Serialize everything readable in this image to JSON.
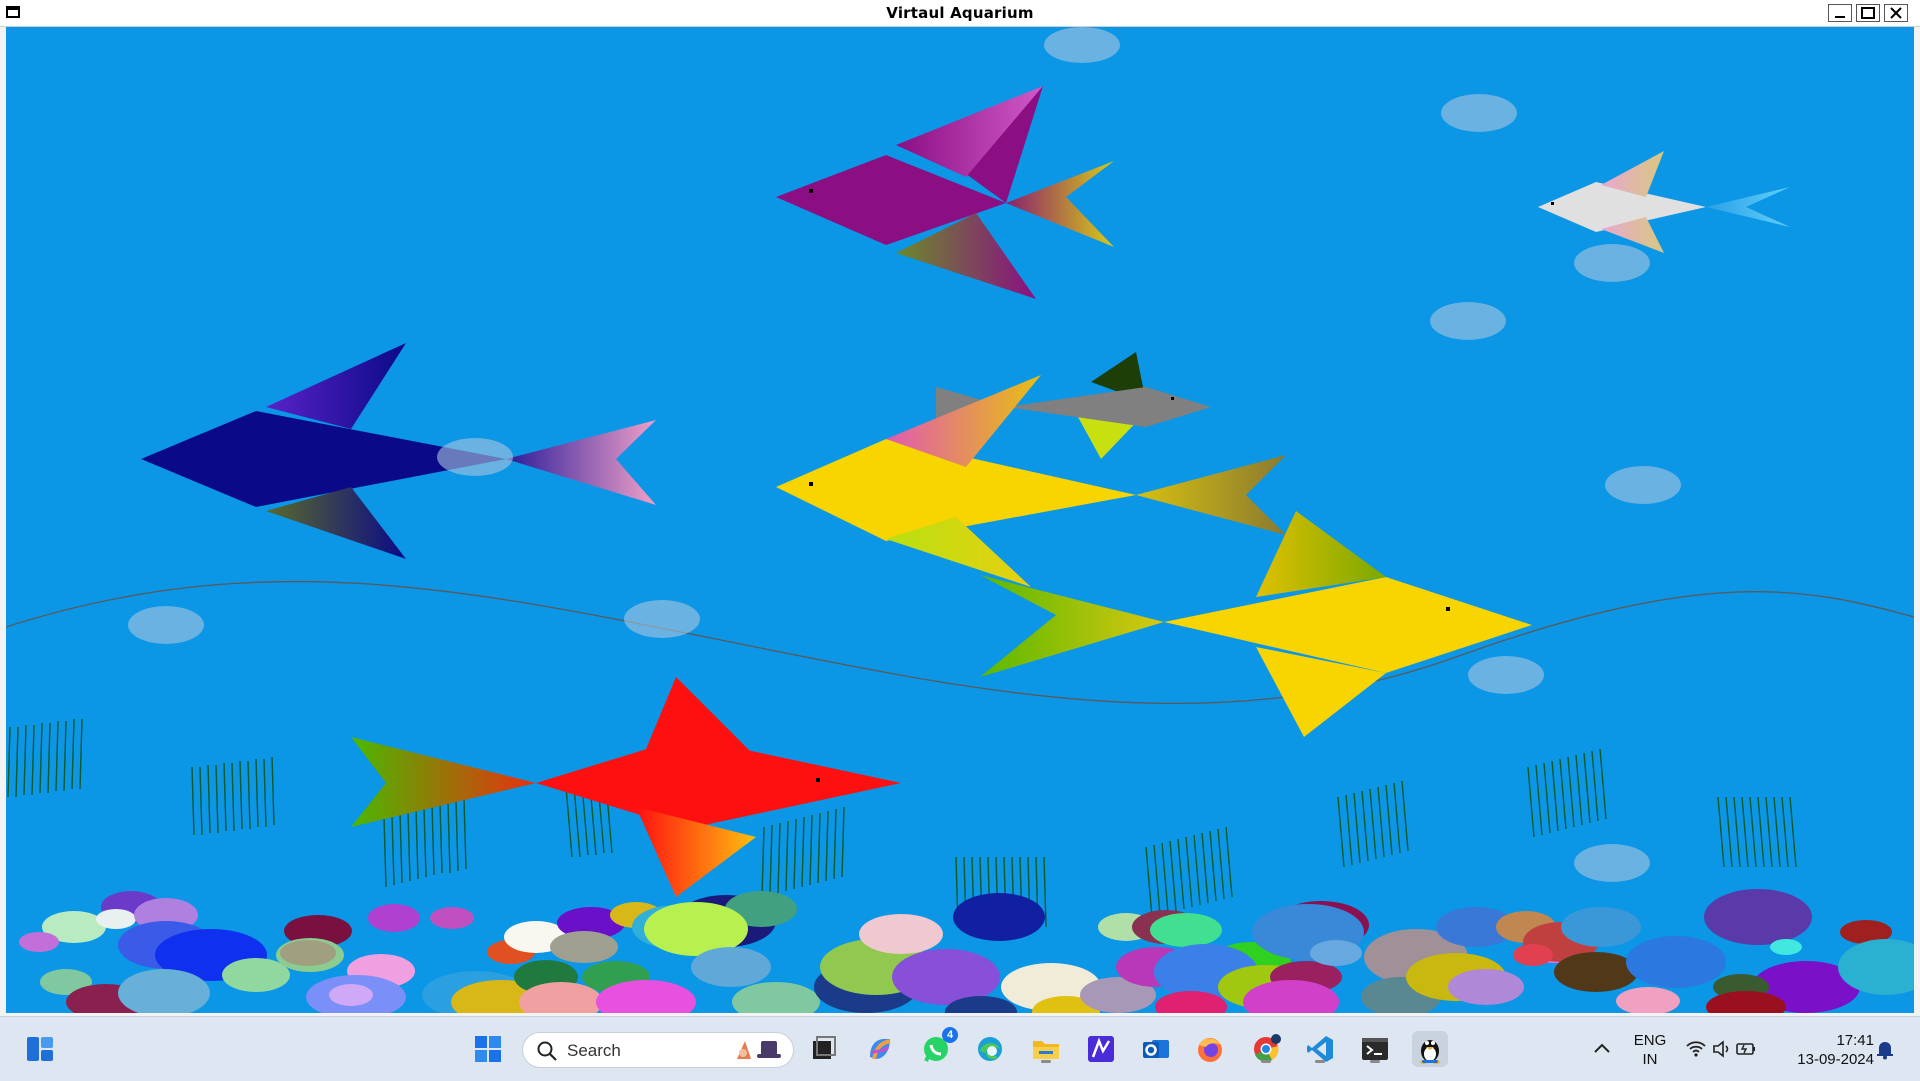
{
  "window": {
    "title": "Virtaul Aquarium"
  },
  "taskbar": {
    "search_placeholder": "Search",
    "whatsapp_badge": "4",
    "language_line1": "ENG",
    "language_line2": "IN",
    "time": "17:41",
    "date": "13-09-2024"
  },
  "colors": {
    "water": "#0b96e6",
    "taskbar": "#dde6f1",
    "accent": "#1a73e8"
  }
}
